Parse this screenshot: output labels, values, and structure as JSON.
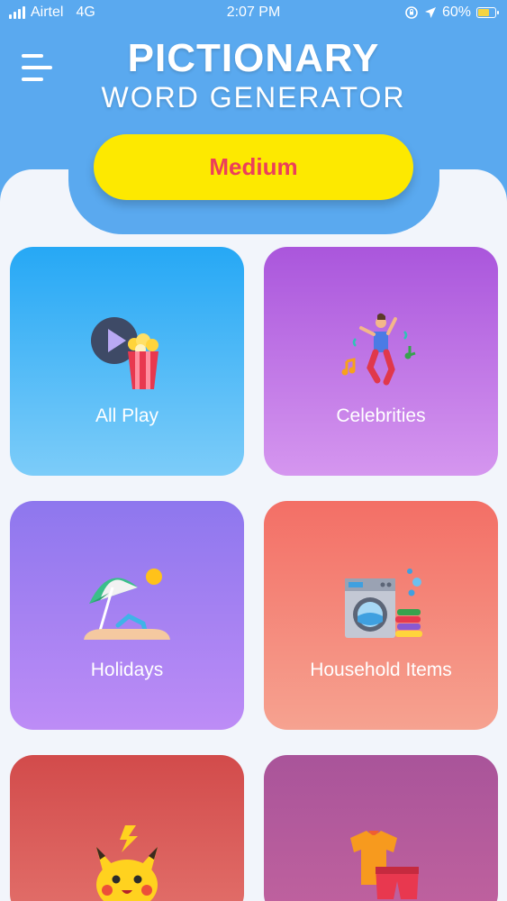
{
  "status_bar": {
    "carrier": "Airtel",
    "network": "4G",
    "time": "2:07 PM",
    "battery": "60%"
  },
  "header": {
    "title_line1": "PICTIONARY",
    "title_line2": "WORD GENERATOR",
    "difficulty": "Medium"
  },
  "colors": {
    "header_blue": "#5aa9ef",
    "difficulty_yellow": "#fde900",
    "difficulty_text": "#ec3f5a"
  },
  "categories": [
    {
      "label": "All Play",
      "icon": "play-popcorn-icon"
    },
    {
      "label": "Celebrities",
      "icon": "dancer-icon"
    },
    {
      "label": "Holidays",
      "icon": "beach-umbrella-icon"
    },
    {
      "label": "Household Items",
      "icon": "washing-machine-icon"
    },
    {
      "label": "",
      "icon": "pikachu-icon"
    },
    {
      "label": "",
      "icon": "clothes-icon"
    }
  ]
}
